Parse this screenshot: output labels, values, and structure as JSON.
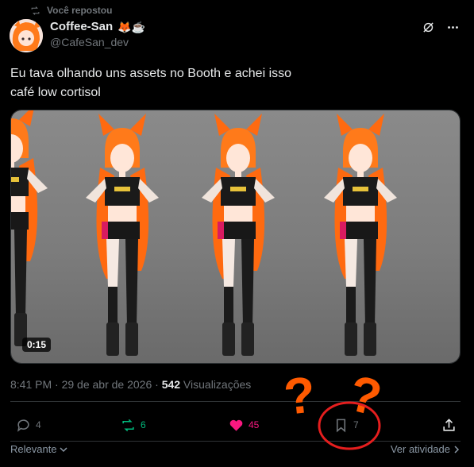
{
  "repost": {
    "label": "Você repostou"
  },
  "author": {
    "name": "Coffee-San",
    "emojis": "🦊☕",
    "handle": "@CafeSan_dev"
  },
  "post": {
    "line1": "Eu tava olhando uns assets no Booth e achei isso",
    "line2": "café low cortisol"
  },
  "media": {
    "duration": "0:15"
  },
  "meta": {
    "datetime": "8:41 PM · 29 de abr de 2026 · ",
    "views_count": "542",
    "views_label": " Visualizações"
  },
  "actions": {
    "replies": "4",
    "reposts": "6",
    "likes": "45",
    "bookmarks": "7"
  },
  "footer": {
    "sort": "Relevante",
    "activity": "Ver atividade"
  },
  "annotations": {
    "question": "?"
  },
  "colors": {
    "background": "#000000",
    "text": "#e7e9ea",
    "muted": "#71767b",
    "repost": "#00ba7c",
    "like": "#f91880",
    "annotation": "#ff5a00",
    "circle": "#e51e1e"
  }
}
